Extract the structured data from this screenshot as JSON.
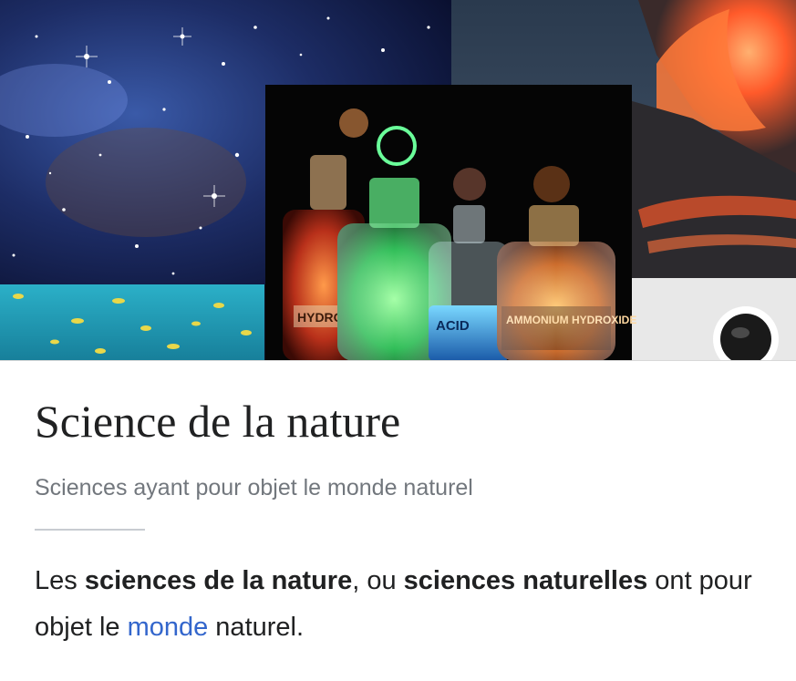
{
  "hero": {
    "image_name": "nature-sciences-collage",
    "panels": [
      "starfield",
      "chemistry-bottles",
      "volcano-eruption",
      "fish-school",
      "eclipse"
    ],
    "bottle_labels": [
      "HYDROCHLORIC",
      "ACID",
      "AMMONIUM HYDROXIDE"
    ]
  },
  "article": {
    "title": "Science de la nature",
    "description": "Sciences ayant pour objet le monde naturel",
    "extract": {
      "t1": "Les ",
      "b1": "sciences de la nature",
      "t2": ", ou ",
      "b2": "sciences naturelles",
      "t3": " ont pour objet le ",
      "link": "monde",
      "t4": " naturel."
    }
  },
  "colors": {
    "title": "#202122",
    "description": "#72777d",
    "link": "#3366cc",
    "divider": "#c8ccd1"
  }
}
